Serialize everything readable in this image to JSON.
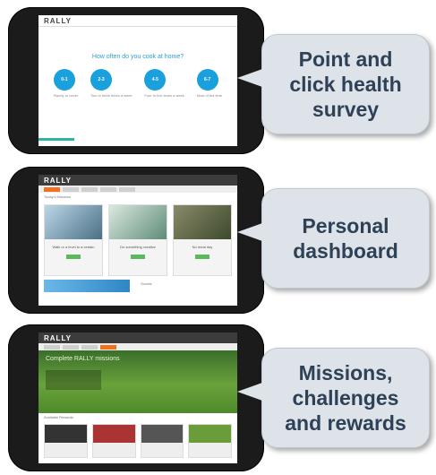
{
  "survey_screen": {
    "logo": "RALLY",
    "question": "How often do you cook at home?",
    "options": [
      {
        "value": "0-1",
        "label": "Rarely or never"
      },
      {
        "value": "2-3",
        "label": "Two to three times a week"
      },
      {
        "value": "4-5",
        "label": "Four to five times a week"
      },
      {
        "value": "6-7",
        "label": "Most of the time"
      }
    ]
  },
  "dashboard_screen": {
    "logo": "RALLY",
    "section_title": "Today's Missions",
    "cards": [
      {
        "title": "Walk or a level to a certain"
      },
      {
        "title": "Do something creative"
      },
      {
        "title": "No meat day"
      }
    ],
    "lower_title": "Guests"
  },
  "rewards_screen": {
    "logo": "RALLY",
    "hero_title": "Complete RALLY missions",
    "section_title": "Available Rewards"
  },
  "callouts": [
    {
      "lines": [
        "Point and",
        "click health",
        "survey"
      ]
    },
    {
      "lines": [
        "Personal",
        "dashboard"
      ]
    },
    {
      "lines": [
        "Missions,",
        "challenges",
        "and rewards"
      ]
    }
  ]
}
